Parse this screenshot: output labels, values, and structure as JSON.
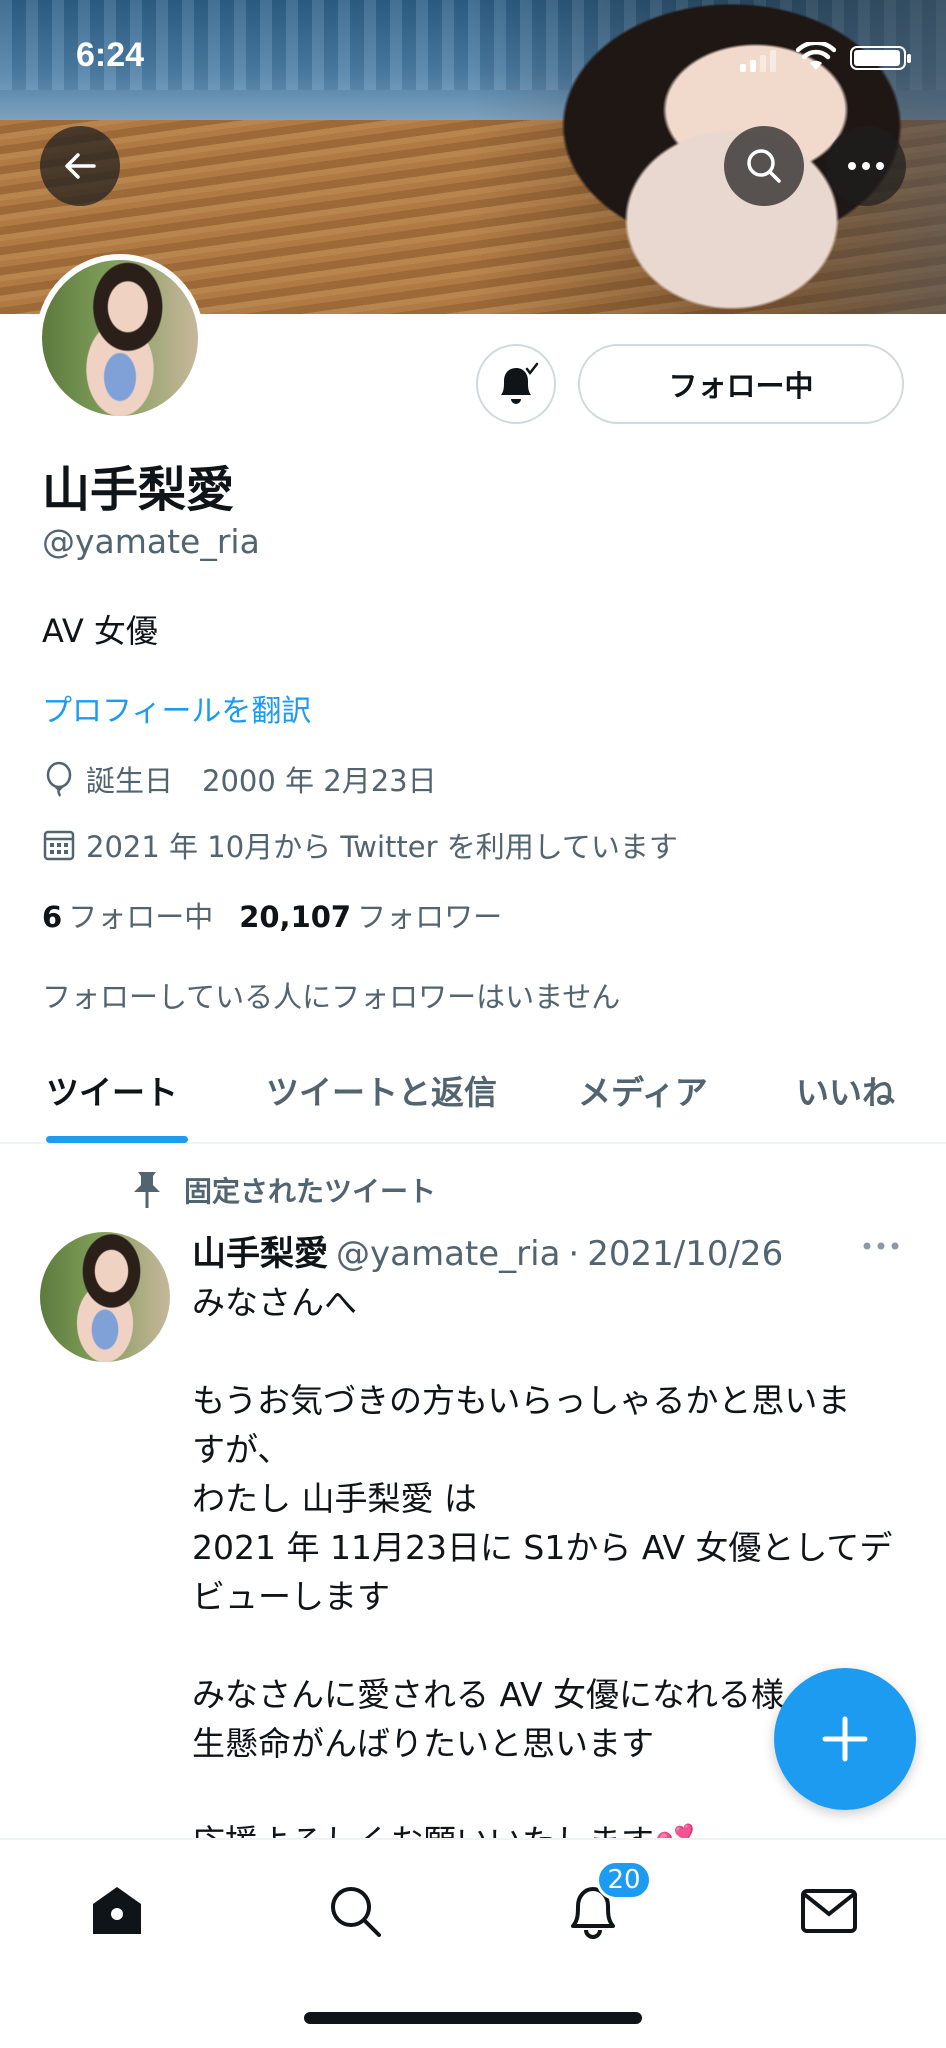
{
  "status_bar": {
    "time": "6:24"
  },
  "profile": {
    "name": "山手梨愛",
    "handle": "@yamate_ria",
    "bio": "AV 女優",
    "translate_label": "プロフィールを翻訳",
    "birthday": "誕生日　2000 年 2月23日",
    "joined": "2021 年 10月から Twitter を利用しています",
    "following_count": "6",
    "following_label": "フォロー中",
    "followers_count": "20,107",
    "followers_label": "フォロワー",
    "mutual_note": "フォローしている人にフォロワーはいません",
    "follow_button_label": "フォロー中"
  },
  "tabs": [
    {
      "label": "ツイート",
      "active": true
    },
    {
      "label": "ツイートと返信",
      "active": false
    },
    {
      "label": "メディア",
      "active": false
    },
    {
      "label": "いいね",
      "active": false
    }
  ],
  "tweet": {
    "pinned_label": "固定されたツイート",
    "author_name": "山手梨愛",
    "author_handle": "@yamate_ria",
    "separator": "·",
    "date": "2021/10/26",
    "lines": [
      "みなさんへ",
      "",
      "もうお気づきの方もいらっしゃるかと思いま",
      "すが、",
      "わたし 山手梨愛 は",
      "2021 年 11月23日に S1から AV 女優としてデ",
      "ビューします",
      "",
      "みなさんに愛される AV 女優になれる様",
      "生懸命がんばりたいと思います",
      "",
      "応援よろしくお願いいたします💕"
    ]
  },
  "nav": {
    "notifications_badge": "20"
  },
  "colors": {
    "accent": "#1d9bf0",
    "text": "#0f1419",
    "secondary": "#536471"
  }
}
